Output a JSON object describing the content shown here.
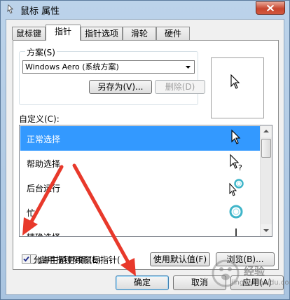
{
  "window": {
    "title": "鼠标 属性"
  },
  "tabs": [
    {
      "label": "鼠标键"
    },
    {
      "label": "指针"
    },
    {
      "label": "指针选项"
    },
    {
      "label": "滑轮"
    },
    {
      "label": "硬件"
    }
  ],
  "scheme": {
    "legend": "方案(S)",
    "selected": "Windows Aero (系统方案)",
    "save_as_label": "另存为(V)...",
    "delete_label": "删除(D)"
  },
  "custom": {
    "label": "自定义(C):",
    "items": [
      {
        "label": "正常选择",
        "cursor_icon": "arrow-cursor-icon"
      },
      {
        "label": "帮助选择",
        "cursor_icon": "help-cursor-icon"
      },
      {
        "label": "后台运行",
        "cursor_icon": "working-cursor-icon"
      },
      {
        "label": "忙",
        "cursor_icon": "busy-cursor-icon"
      },
      {
        "label": "精确选择",
        "cursor_icon": "precision-cursor-icon"
      }
    ]
  },
  "options": {
    "shadow_label": "启用指针阴影(E)",
    "shadow_checked": false,
    "use_default_label": "使用默认值(F)",
    "browse_label": "浏览(B)...",
    "theme_label": "允许主题更改鼠标指针(",
    "theme_checked": true
  },
  "footer": {
    "ok_label": "确定",
    "cancel_label": "取消",
    "apply_label": "应用(A)"
  },
  "watermark": {
    "text": "经验",
    "sub": "jingyan.baidu.com"
  },
  "colors": {
    "selection": "#3399ff",
    "annotation_arrow": "#e8392b"
  }
}
